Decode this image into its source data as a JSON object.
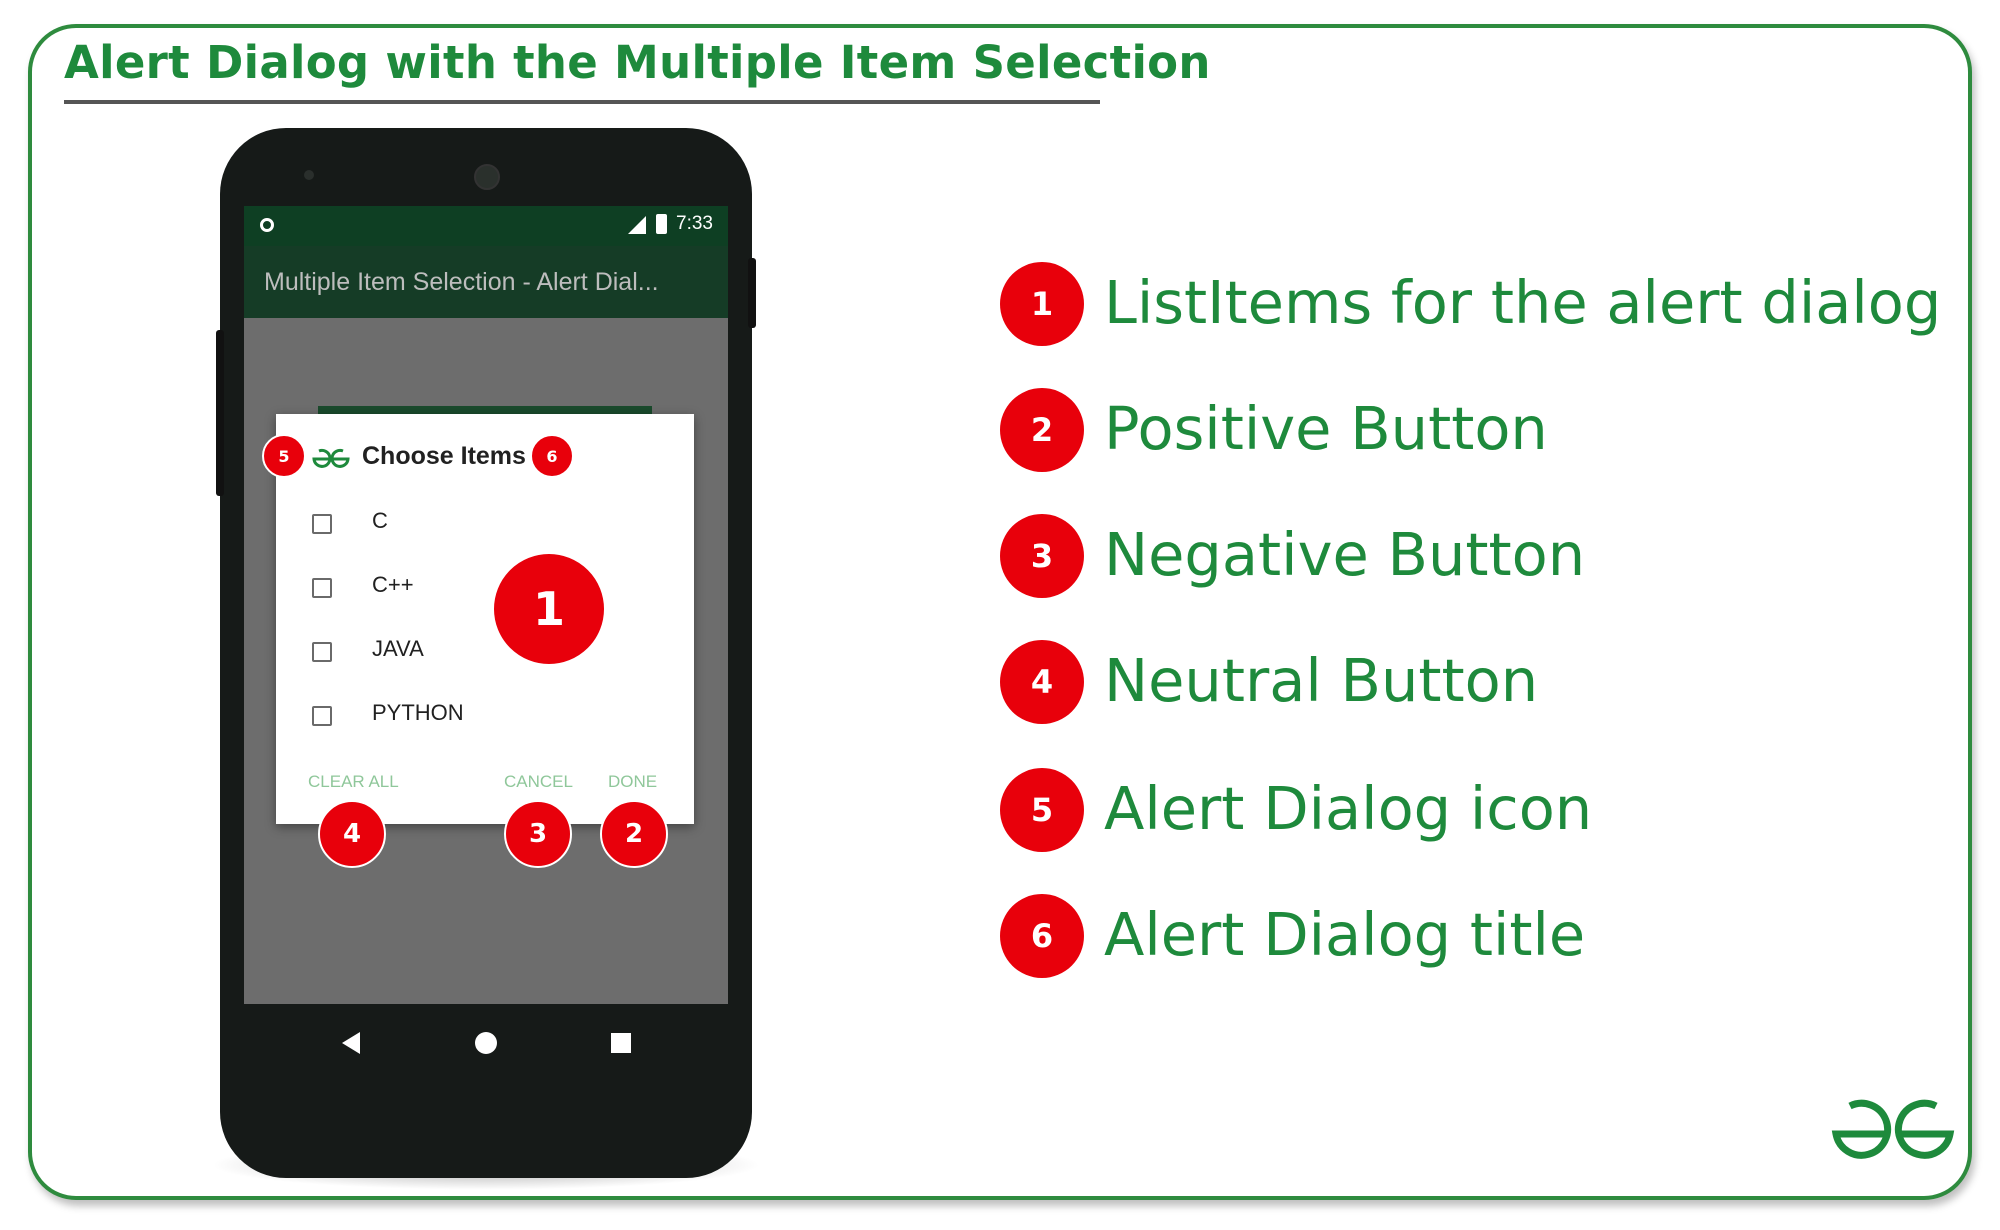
{
  "heading": "Alert Dialog with the Multiple Item Selection",
  "phone": {
    "status_time": "7:33",
    "app_title": "Multiple Item Selection - Alert Dial...",
    "dialog": {
      "title": "Choose Items",
      "items": [
        "C",
        "C++",
        "JAVA",
        "PYTHON"
      ],
      "checked": [
        false,
        false,
        false,
        false
      ],
      "neutral_button": "CLEAR ALL",
      "negative_button": "CANCEL",
      "positive_button": "DONE"
    }
  },
  "callouts": {
    "list_items": "1",
    "positive": "2",
    "negative": "3",
    "neutral": "4",
    "icon": "5",
    "title": "6"
  },
  "legend": [
    {
      "number": "1",
      "label": "ListItems for the alert dialog"
    },
    {
      "number": "2",
      "label": "Positive Button"
    },
    {
      "number": "3",
      "label": "Negative Button"
    },
    {
      "number": "4",
      "label": "Neutral Button"
    },
    {
      "number": "5",
      "label": "Alert Dialog icon"
    },
    {
      "number": "6",
      "label": "Alert Dialog title"
    }
  ],
  "colors": {
    "brand_green": "#1e8a3c",
    "badge_red": "#e8000b",
    "status_bar": "#0e3f23",
    "app_bar": "#153c26",
    "button_text": "#8fc79a"
  },
  "icons": {
    "dialog_icon": "gfg-logo-icon",
    "corner_logo": "gfg-logo-icon"
  }
}
